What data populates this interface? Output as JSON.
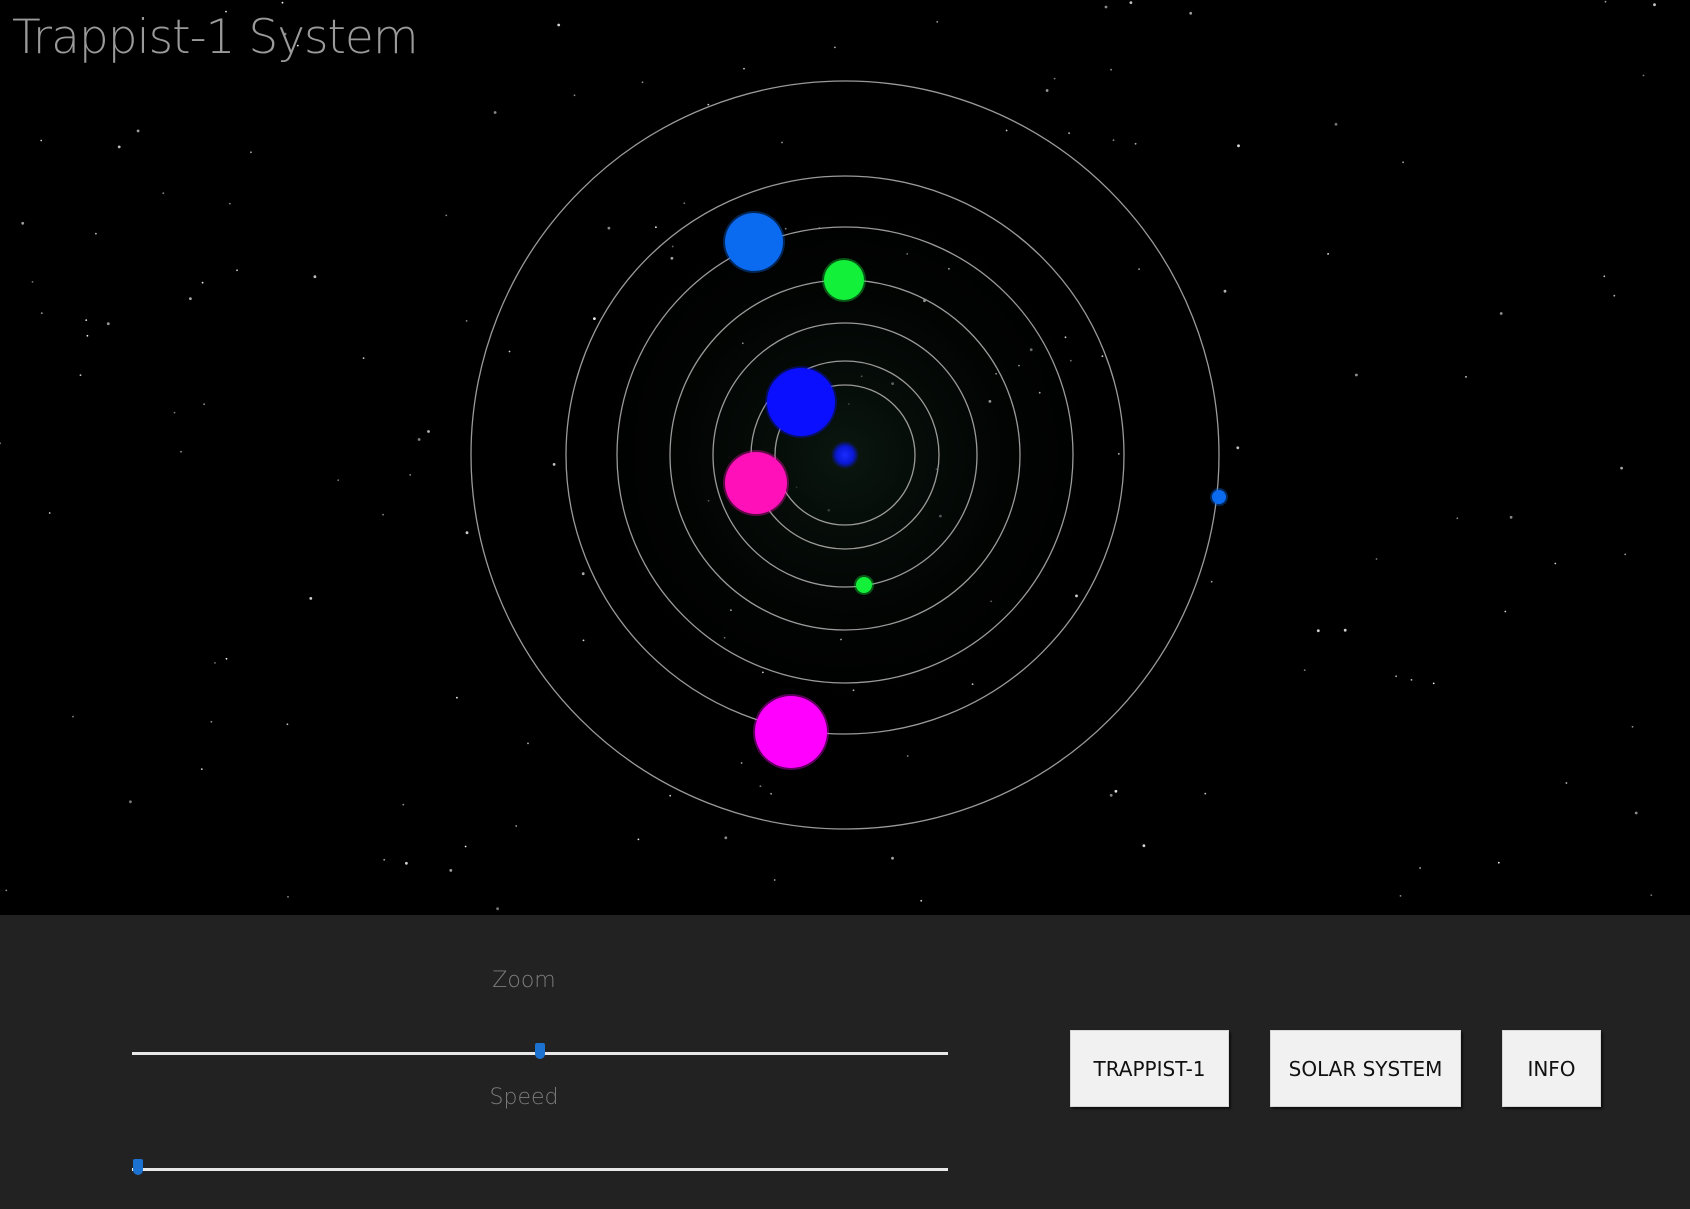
{
  "title": "Trappist-1 System",
  "controls": {
    "zoom": {
      "label": "Zoom",
      "value": 0.5
    },
    "speed": {
      "label": "Speed",
      "value": 0.0
    }
  },
  "buttons": {
    "trappist": "TRAPPIST-1",
    "solar": "SOLAR SYSTEM",
    "info": "INFO"
  },
  "colors": {
    "space_background": "#000000",
    "panel_background": "#222222",
    "orbit_line": "#9a9a9a",
    "star": "#0a18d8",
    "slider_thumb": "#1b72d1",
    "planet_blue": "#0a6bf0",
    "planet_deep_blue": "#0a10ff",
    "planet_green": "#12f03a",
    "planet_magenta": "#ff00ff",
    "planet_pink": "#ff10b8"
  },
  "planets": [
    {
      "name": "planet-deep-blue",
      "color": "#0a10ff"
    },
    {
      "name": "planet-pink",
      "color": "#ff10b8"
    },
    {
      "name": "planet-green-small",
      "color": "#12f03a"
    },
    {
      "name": "planet-blue",
      "color": "#0a6bf0"
    },
    {
      "name": "planet-green",
      "color": "#12f03a"
    },
    {
      "name": "planet-magenta",
      "color": "#ff00ff"
    },
    {
      "name": "planet-blue-small",
      "color": "#0a6bf0"
    }
  ]
}
